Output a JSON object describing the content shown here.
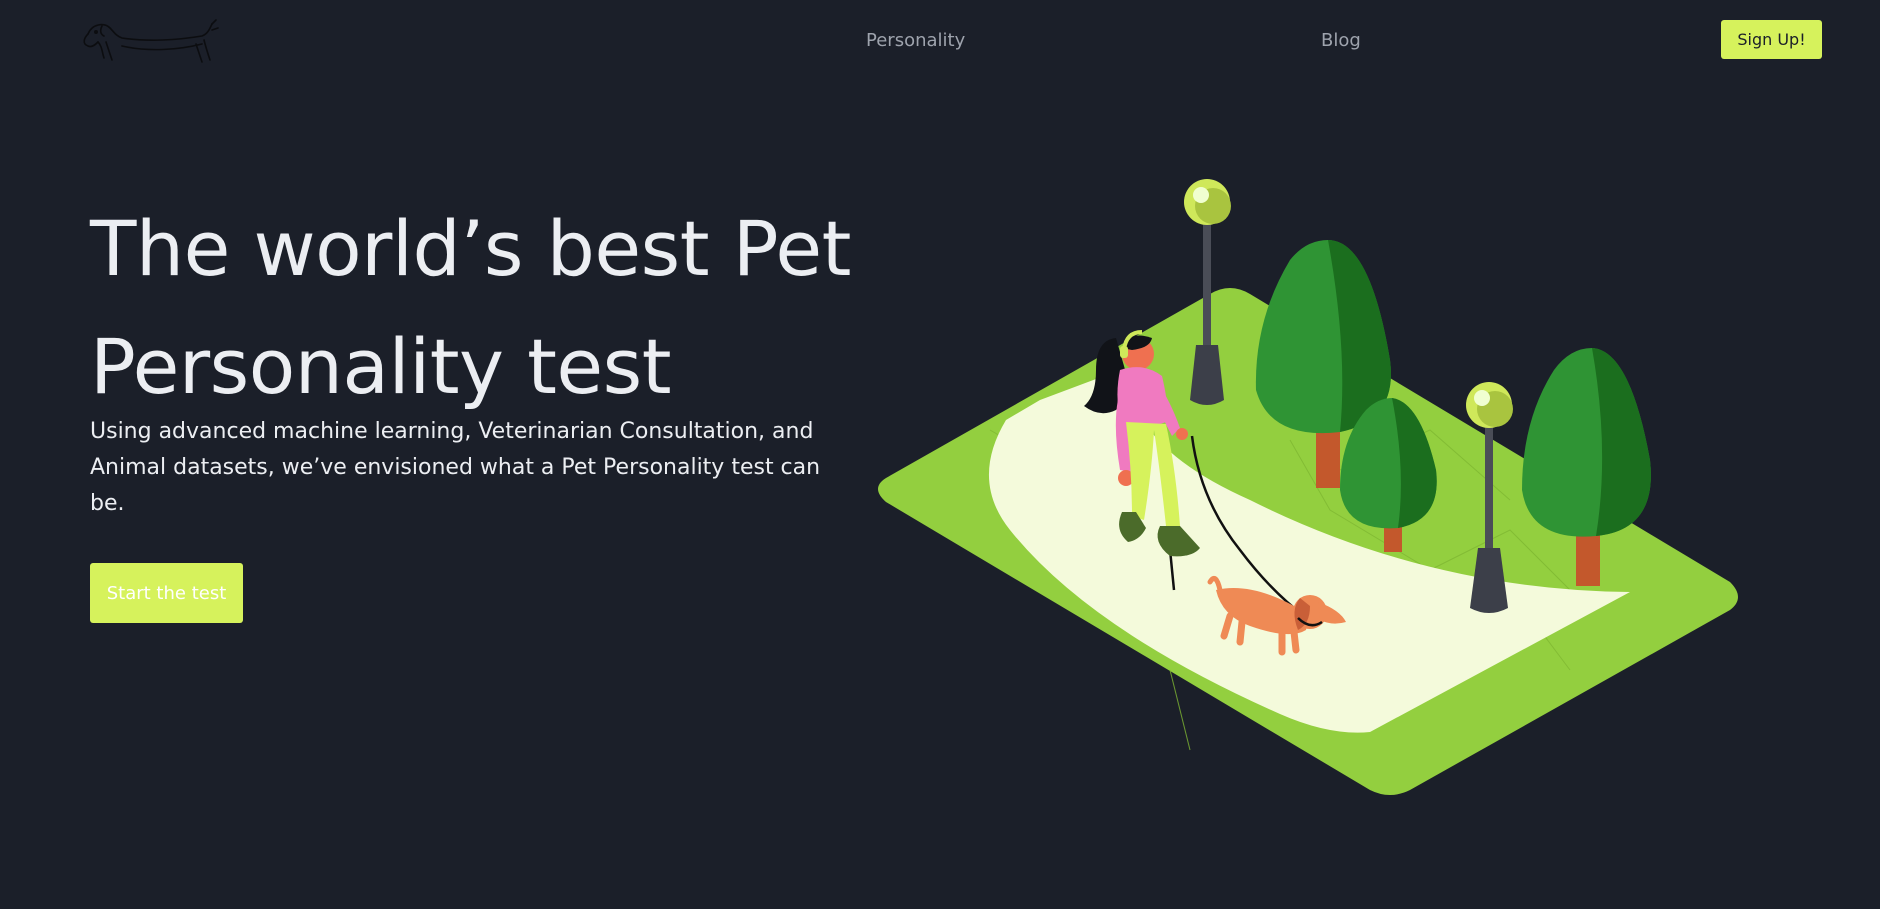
{
  "nav": {
    "links": [
      "Personality",
      "Blog"
    ],
    "signup_label": "Sign Up!"
  },
  "hero": {
    "title_line1": "The world’s best Pet",
    "title_line2": "Personality test",
    "description": "Using advanced machine learning, Veterinarian Consultation, and Animal datasets, we’ve envisioned what a Pet Personality test can be.",
    "cta_label": "Start the test"
  },
  "colors": {
    "background": "#1b1f29",
    "accent": "#d6f25c",
    "text": "#eceef2",
    "nav_text": "#9ea3ad",
    "grass": "#93cf3f",
    "path": "#f4fadb",
    "tree_light": "#2f9434",
    "tree_dark": "#1b6e1e",
    "trunk": "#c3582c",
    "dog": "#ef8a55",
    "shirt": "#f07ac0"
  },
  "icons": {
    "logo": "dachshund-logo-icon"
  }
}
